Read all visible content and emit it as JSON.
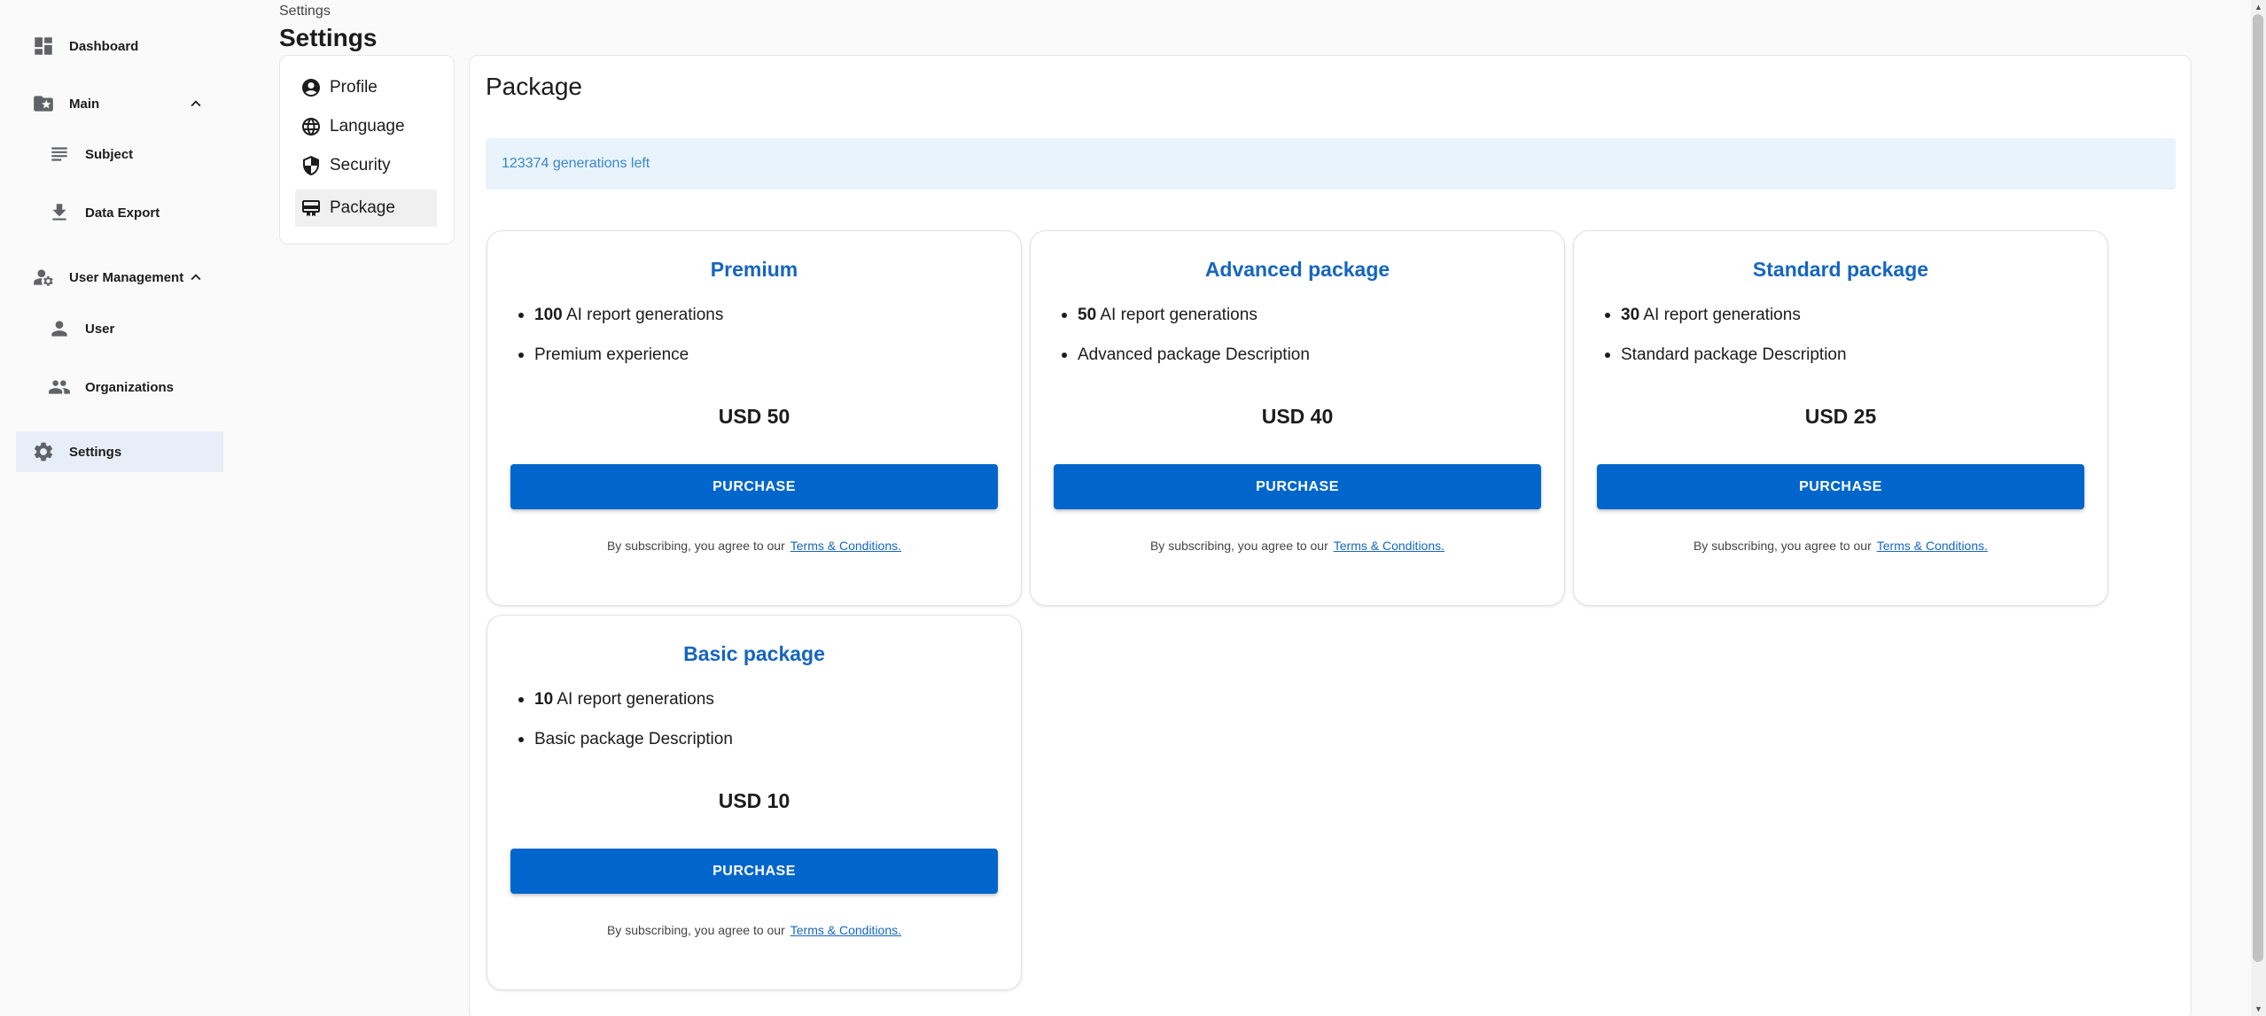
{
  "sidebar": {
    "items": [
      {
        "label": "Dashboard",
        "icon": "dashboard-icon"
      },
      {
        "label": "Main",
        "icon": "folder-star-icon"
      },
      {
        "label": "Subject",
        "icon": "subject-icon"
      },
      {
        "label": "Data Export",
        "icon": "download-icon"
      },
      {
        "label": "User Management",
        "icon": "manage-accounts-icon"
      },
      {
        "label": "User",
        "icon": "person-icon"
      },
      {
        "label": "Organizations",
        "icon": "groups-icon"
      },
      {
        "label": "Settings",
        "icon": "gear-icon"
      }
    ],
    "active": "Settings"
  },
  "header": {
    "breadcrumb": "Settings",
    "title": "Settings"
  },
  "settings_menu": {
    "items": [
      {
        "label": "Profile",
        "icon": "account-circle-icon"
      },
      {
        "label": "Language",
        "icon": "globe-icon"
      },
      {
        "label": "Security",
        "icon": "shield-icon"
      },
      {
        "label": "Package",
        "icon": "package-icon"
      }
    ],
    "active": "Package"
  },
  "main": {
    "title": "Package",
    "info": "123374 generations left",
    "packages": [
      {
        "name": "Premium",
        "count": "100",
        "count_text": "AI report generations",
        "description": "Premium experience",
        "price": "USD 50",
        "button": "PURCHASE",
        "terms_text": "By subscribing, you agree to our",
        "terms_link": "Terms & Conditions."
      },
      {
        "name": "Advanced package",
        "count": "50",
        "count_text": "AI report generations",
        "description": "Advanced package Description",
        "price": "USD 40",
        "button": "PURCHASE",
        "terms_text": "By subscribing, you agree to our",
        "terms_link": "Terms & Conditions."
      },
      {
        "name": "Standard package",
        "count": "30",
        "count_text": "AI report generations",
        "description": "Standard package Description",
        "price": "USD 25",
        "button": "PURCHASE",
        "terms_text": "By subscribing, you agree to our",
        "terms_link": "Terms & Conditions."
      },
      {
        "name": "Basic package",
        "count": "10",
        "count_text": "AI report generations",
        "description": "Basic package Description",
        "price": "USD 10",
        "button": "PURCHASE",
        "terms_text": "By subscribing, you agree to our",
        "terms_link": "Terms & Conditions."
      }
    ]
  },
  "colors": {
    "accent": "#0066cc",
    "title_blue": "#1565c0",
    "info_bg": "#e8f3fc",
    "info_text": "#3a87c9",
    "sidebar_active_bg": "#e8eef7"
  }
}
